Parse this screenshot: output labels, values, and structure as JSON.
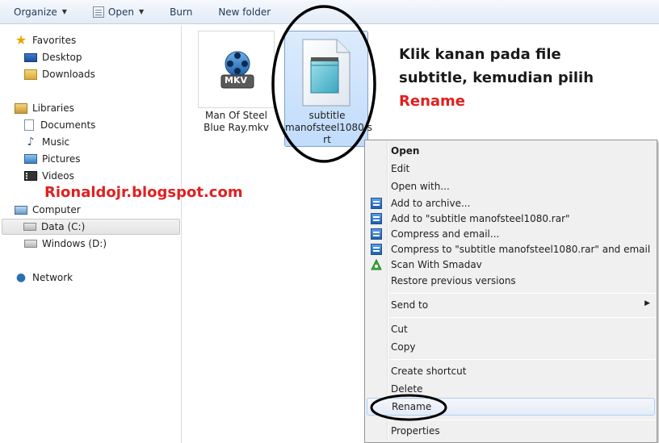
{
  "toolbar": {
    "organize": "Organize",
    "open": "Open",
    "burn": "Burn",
    "new_folder": "New folder"
  },
  "nav": {
    "favorites": "Favorites",
    "desktop": "Desktop",
    "downloads": "Downloads",
    "libraries": "Libraries",
    "documents": "Documents",
    "music": "Music",
    "pictures": "Pictures",
    "videos": "Videos",
    "computer": "Computer",
    "data_c": "Data (C:)",
    "windows_d": "Windows (D:)",
    "network": "Network"
  },
  "files": [
    {
      "name_line1": "Man Of Steel",
      "name_line2": "Blue Ray.mkv",
      "icon": "mkv-file-icon",
      "badge": "MKV"
    },
    {
      "name_line1": "subtitle",
      "name_line2": "manofsteel1080.s",
      "name_line3": "rt",
      "icon": "notepad-file-icon"
    }
  ],
  "annotation": {
    "line1": "Klik kanan pada file",
    "line2": "subtitle, kemudian pilih",
    "line3": "Rename"
  },
  "watermark": "Rionaldojr.blogspot.com",
  "context_menu": {
    "open": "Open",
    "edit": "Edit",
    "open_with": "Open with...",
    "add_archive": "Add to archive...",
    "add_rar": "Add to \"subtitle manofsteel1080.rar\"",
    "compress_email": "Compress and email...",
    "compress_rar_email": "Compress to \"subtitle manofsteel1080.rar\" and email",
    "scan_smadav": "Scan With Smadav",
    "restore": "Restore previous versions",
    "send_to": "Send to",
    "cut": "Cut",
    "copy": "Copy",
    "create_shortcut": "Create shortcut",
    "delete": "Delete",
    "rename": "Rename",
    "properties": "Properties"
  },
  "colors": {
    "annotation_red": "#e02020",
    "selection_blue": "#c1dcfc",
    "toolbar_text": "#1e395b"
  }
}
